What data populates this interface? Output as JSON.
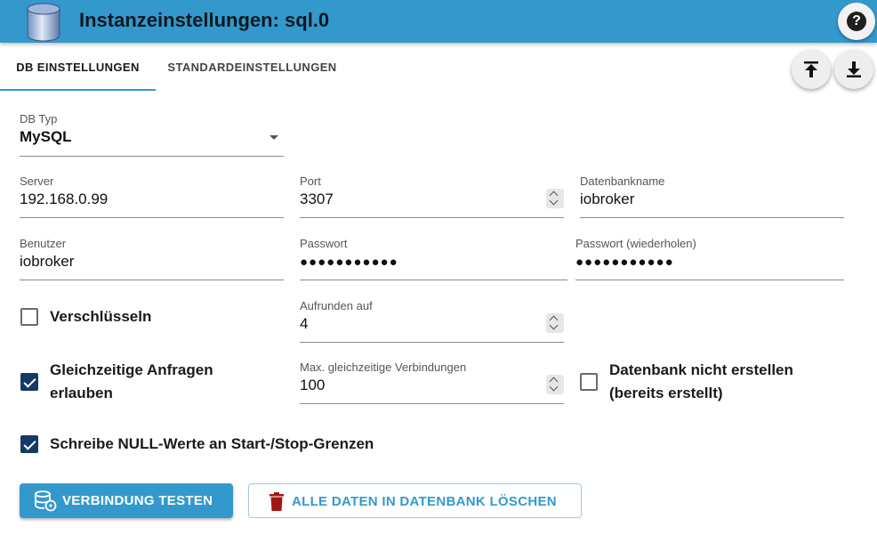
{
  "header": {
    "title": "Instanzeinstellungen: sql.0",
    "logo_icon": "database-cylinder-icon",
    "help_icon": "question-mark-icon",
    "color": "#3399cc"
  },
  "tabs": [
    {
      "label": "DB EINSTELLUNGEN",
      "active": true
    },
    {
      "label": "STANDARDEINSTELLUNGEN",
      "active": false
    }
  ],
  "actions": {
    "upload_icon": "upload-icon",
    "download_icon": "download-icon"
  },
  "form": {
    "db_type": {
      "label": "DB Typ",
      "value": "MySQL"
    },
    "server": {
      "label": "Server",
      "value": "192.168.0.99"
    },
    "port": {
      "label": "Port",
      "value": "3307"
    },
    "db_name": {
      "label": "Datenbankname",
      "value": "iobroker"
    },
    "user": {
      "label": "Benutzer",
      "value": "iobroker"
    },
    "password": {
      "label": "Passwort",
      "value": "●●●●●●●●●●●"
    },
    "password_repeat": {
      "label": "Passwort (wiederholen)",
      "value": "●●●●●●●●●●●"
    },
    "encrypt": {
      "label": "Verschlüsseln",
      "checked": false
    },
    "round": {
      "label": "Aufrunden auf",
      "value": "4"
    },
    "parallel": {
      "label_line1": "Gleichzeitige Anfragen",
      "label_line2": "erlauben",
      "checked": true
    },
    "max_connections": {
      "label": "Max. gleichzeitige Verbindungen",
      "value": "100"
    },
    "no_create": {
      "label_line1": "Datenbank nicht erstellen",
      "label_line2": "(bereits erstellt)",
      "checked": false
    },
    "write_nulls": {
      "label": "Schreibe NULL-Werte an Start-/Stop-Grenzen",
      "checked": true
    }
  },
  "buttons": {
    "test": {
      "label": "VERBINDUNG TESTEN",
      "icon": "database-connection-icon"
    },
    "delete": {
      "label": "ALLE DATEN IN DATENBANK LÖSCHEN",
      "icon": "trash-icon",
      "icon_color": "#a31515"
    }
  }
}
